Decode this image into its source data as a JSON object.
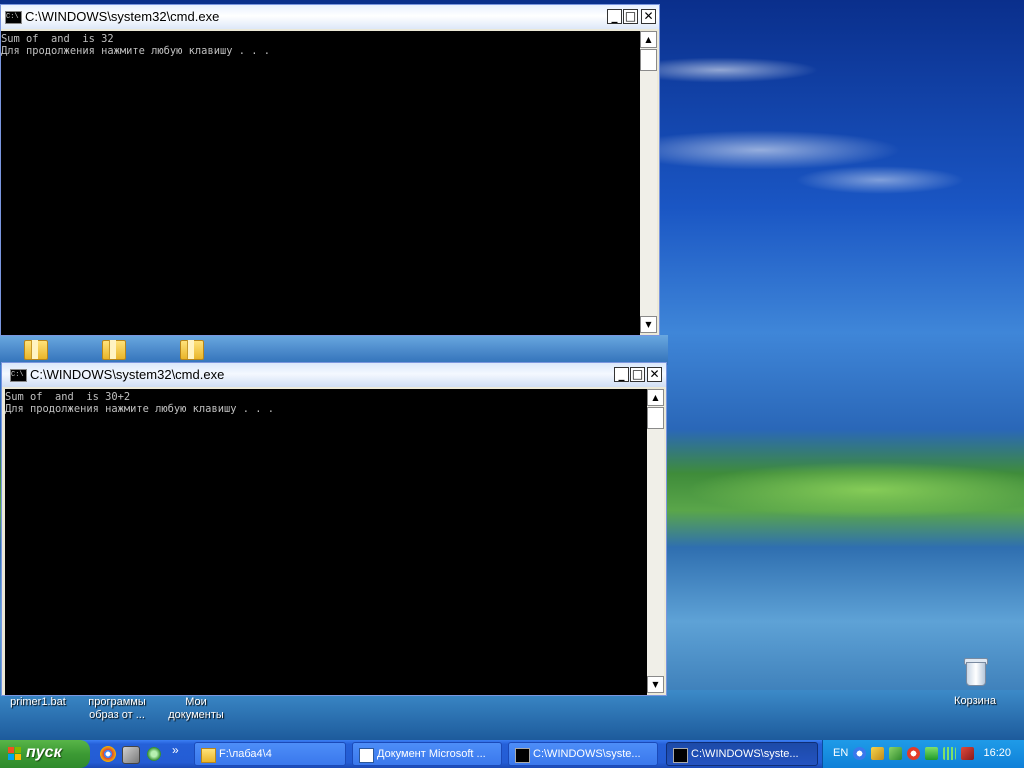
{
  "windows": [
    {
      "title": "C:\\WINDOWS\\system32\\cmd.exe",
      "console_lines": [
        "Sum of  and  is 32",
        "Для продолжения нажмите любую клавишу . . ."
      ]
    },
    {
      "title": "C:\\WINDOWS\\system32\\cmd.exe",
      "console_lines": [
        "Sum of  and  is 30+2",
        "Для продолжения нажмите любую клавишу . . ."
      ]
    }
  ],
  "title_icon_text": "C:\\",
  "window_buttons": {
    "minimize": "_",
    "maximize": "□",
    "close": "✕"
  },
  "scroll_buttons": {
    "up": "▲",
    "down": "▼"
  },
  "desktop_icons": [
    {
      "label": "primer1.bat",
      "icon": "folder-icon"
    },
    {
      "label": "программы образ от ...",
      "icon": "folder-icon"
    },
    {
      "label": "Мои документы",
      "icon": "folder-icon"
    },
    {
      "label": "Корзина",
      "icon": "recycle-bin-icon"
    }
  ],
  "taskbar": {
    "start_label": "пуск",
    "quick_launch_more": "»",
    "tasks": [
      {
        "label": "F:\\лаба4\\4",
        "icon": "folder-icon",
        "active": false
      },
      {
        "label": "Документ Microsoft ...",
        "icon": "word-icon",
        "active": false
      },
      {
        "label": "C:\\WINDOWS\\syste...",
        "icon": "cmd-icon",
        "active": false
      },
      {
        "label": "C:\\WINDOWS\\syste...",
        "icon": "cmd-icon",
        "active": true
      }
    ],
    "language": "EN",
    "clock": "16:20"
  }
}
